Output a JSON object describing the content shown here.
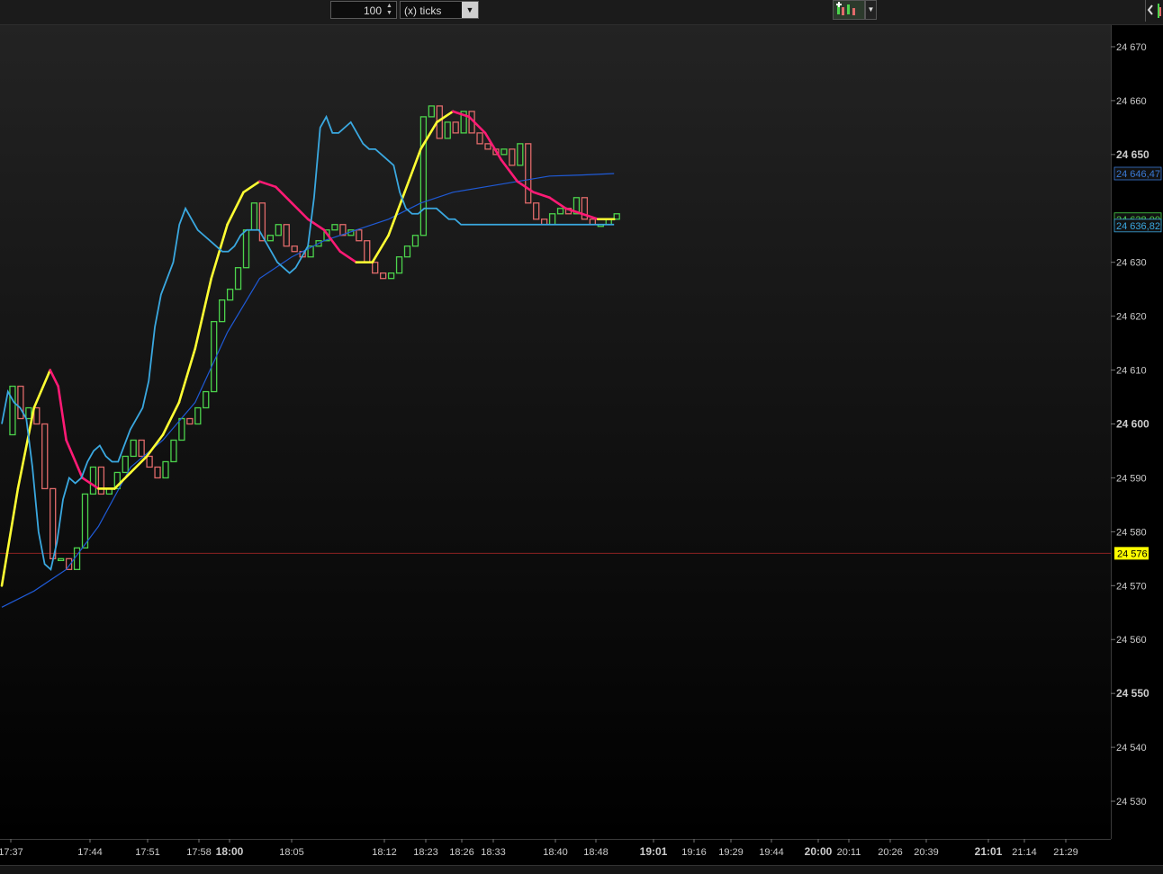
{
  "toolbar": {
    "period_value": "100",
    "period_unit": "(x) ticks"
  },
  "icons": {
    "spinner": "spinner-arrows-icon",
    "dropdown": "chevron-down-icon",
    "drawing_tools": "drawing-tools-icon",
    "chart_settings": "chart-settings-icon"
  },
  "colors": {
    "background_top": "#232323",
    "background_bottom": "#000000",
    "up_bar": "#4cd34c",
    "down_bar": "#e06a6a",
    "ma_fast": "#3aa8e0",
    "ma_rising": "#ffff33",
    "ma_falling": "#ff1a75",
    "ma_slow": "#1f5ad6",
    "reference_line": "#8b2020",
    "reference_label_bg": "#ffff00"
  },
  "chart_data": {
    "type": "line",
    "y_axis": {
      "range": [
        24523,
        24674
      ],
      "ticks": [
        {
          "value": 24670,
          "label": "24 670",
          "bold": false
        },
        {
          "value": 24660,
          "label": "24 660",
          "bold": false
        },
        {
          "value": 24650,
          "label": "24 650",
          "bold": true
        },
        {
          "value": 24630,
          "label": "24 630",
          "bold": false
        },
        {
          "value": 24620,
          "label": "24 620",
          "bold": false
        },
        {
          "value": 24610,
          "label": "24 610",
          "bold": false
        },
        {
          "value": 24600,
          "label": "24 600",
          "bold": true
        },
        {
          "value": 24590,
          "label": "24 590",
          "bold": false
        },
        {
          "value": 24580,
          "label": "24 580",
          "bold": false
        },
        {
          "value": 24570,
          "label": "24 570",
          "bold": false
        },
        {
          "value": 24560,
          "label": "24 560",
          "bold": false
        },
        {
          "value": 24550,
          "label": "24 550",
          "bold": true
        },
        {
          "value": 24540,
          "label": "24 540",
          "bold": false
        },
        {
          "value": 24530,
          "label": "24 530",
          "bold": false
        }
      ]
    },
    "x_axis": {
      "ticks": [
        {
          "label": "17:37",
          "bold": false
        },
        {
          "label": "17:44",
          "bold": false
        },
        {
          "label": "17:51",
          "bold": false
        },
        {
          "label": "17:58",
          "bold": false
        },
        {
          "label": "18:00",
          "bold": true
        },
        {
          "label": "18:05",
          "bold": false
        },
        {
          "label": "18:12",
          "bold": false
        },
        {
          "label": "18:23",
          "bold": false
        },
        {
          "label": "18:26",
          "bold": false
        },
        {
          "label": "18:33",
          "bold": false
        },
        {
          "label": "18:40",
          "bold": false
        },
        {
          "label": "18:48",
          "bold": false
        },
        {
          "label": "19:01",
          "bold": true
        },
        {
          "label": "19:16",
          "bold": false
        },
        {
          "label": "19:29",
          "bold": false
        },
        {
          "label": "19:44",
          "bold": false
        },
        {
          "label": "20:00",
          "bold": true
        },
        {
          "label": "20:11",
          "bold": false
        },
        {
          "label": "20:26",
          "bold": false
        },
        {
          "label": "20:39",
          "bold": false
        },
        {
          "label": "21:01",
          "bold": true
        },
        {
          "label": "21:14",
          "bold": false
        },
        {
          "label": "21:29",
          "bold": false
        }
      ]
    },
    "reference_line": {
      "value": 24576,
      "label": "24 576"
    },
    "last_value_labels": [
      {
        "value": 24646.47,
        "label": "24 646,47",
        "color": "#3a7ad6"
      },
      {
        "value": 24638.0,
        "label": "24 638,00",
        "color": "#4cd34c"
      },
      {
        "value": 24636.82,
        "label": "24 636,82",
        "color": "#3aa8e0"
      }
    ],
    "price_steps": [
      24598,
      24607,
      24601,
      24603,
      24600,
      24588,
      24575,
      24575,
      24573,
      24577,
      24587,
      24592,
      24587,
      24588,
      24591,
      24594,
      24597,
      24594,
      24592,
      24590,
      24593,
      24597,
      24601,
      24600,
      24603,
      24606,
      24619,
      24623,
      24625,
      24629,
      24636,
      24641,
      24634,
      24635,
      24637,
      24633,
      24632,
      24631,
      24633,
      24634,
      24636,
      24637,
      24635,
      24636,
      24634,
      24630,
      24628,
      24627,
      24628,
      24631,
      24633,
      24635,
      24657,
      24659,
      24653,
      24656,
      24654,
      24658,
      24654,
      24652,
      24651,
      24650,
      24651,
      24648,
      24652,
      24641,
      24638,
      24637,
      24639,
      24640,
      24639,
      24642,
      24638,
      24637,
      24637,
      24638,
      24639
    ],
    "series": [
      {
        "style": "fast",
        "x": [
          0.0,
          0.01,
          0.02,
          0.03,
          0.04,
          0.05,
          0.06,
          0.07,
          0.08,
          0.09,
          0.1,
          0.11,
          0.12,
          0.13,
          0.14,
          0.15,
          0.16,
          0.17,
          0.18,
          0.19,
          0.2,
          0.21,
          0.22,
          0.23,
          0.24,
          0.25,
          0.26,
          0.27,
          0.28,
          0.29,
          0.3,
          0.31,
          0.32,
          0.33,
          0.34,
          0.35,
          0.36,
          0.37,
          0.38,
          0.39,
          0.4,
          0.41,
          0.42,
          0.43,
          0.44,
          0.45,
          0.46,
          0.47,
          0.48,
          0.49,
          0.5,
          0.51,
          0.52,
          0.53,
          0.54,
          0.55,
          0.56,
          0.57,
          0.58,
          0.59,
          0.6,
          0.61,
          0.62,
          0.63,
          0.64,
          0.65,
          0.66,
          0.67,
          0.68,
          0.69,
          0.7,
          0.71,
          0.72,
          0.73,
          0.74,
          0.75,
          0.76,
          0.77,
          0.78,
          0.79,
          0.8,
          0.81,
          0.82,
          0.83,
          0.84,
          0.85,
          0.86,
          0.87,
          0.88,
          0.89,
          0.9,
          0.91,
          0.92,
          0.93,
          0.94,
          0.95,
          0.96,
          0.97,
          0.98,
          0.99,
          1.0
        ],
        "values": [
          24600,
          24606,
          24604,
          24603,
          24601,
          24592,
          24580,
          24574,
          24573,
          24578,
          24586,
          24590,
          24589,
          24590,
          24593,
          24595,
          24596,
          24594,
          24593,
          24593,
          24596,
          24599,
          24601,
          24603,
          24608,
          24618,
          24624,
          24627,
          24630,
          24637,
          24640,
          24638,
          24636,
          24635,
          24634,
          24633,
          24632,
          24632,
          24633,
          24635,
          24636,
          24636,
          24636,
          24634,
          24632,
          24630,
          24629,
          24628,
          24629,
          24631,
          24633,
          24642,
          24655,
          24657,
          24654,
          24654,
          24655,
          24656,
          24654,
          24652,
          24651,
          24651,
          24650,
          24649,
          24648,
          24643,
          24640,
          24639,
          24639,
          24640,
          24640,
          24640,
          24639,
          24638,
          24638,
          24637,
          24637,
          24637,
          24637,
          24637,
          24637,
          24637,
          24637,
          24637,
          24637,
          24637,
          24637,
          24637,
          24637,
          24637,
          24637,
          24637,
          24637,
          24637,
          24637,
          24637,
          24637,
          24637,
          24637,
          24637,
          24637
        ]
      },
      {
        "style": "trend",
        "points": [
          [
            0,
            24570
          ],
          [
            2,
            24588
          ],
          [
            4,
            24603
          ],
          [
            6,
            24610
          ],
          [
            7,
            24607
          ],
          [
            8,
            24597
          ],
          [
            10,
            24590
          ],
          [
            12,
            24588
          ],
          [
            14,
            24588
          ],
          [
            16,
            24591
          ],
          [
            18,
            24594
          ],
          [
            20,
            24598
          ],
          [
            22,
            24604
          ],
          [
            24,
            24614
          ],
          [
            26,
            24627
          ],
          [
            28,
            24637
          ],
          [
            30,
            24643
          ],
          [
            32,
            24645
          ],
          [
            34,
            24644
          ],
          [
            36,
            24641
          ],
          [
            38,
            24638
          ],
          [
            40,
            24636
          ],
          [
            42,
            24632
          ],
          [
            44,
            24630
          ],
          [
            46,
            24630
          ],
          [
            48,
            24635
          ],
          [
            50,
            24643
          ],
          [
            52,
            24651
          ],
          [
            54,
            24656
          ],
          [
            56,
            24658
          ],
          [
            58,
            24657
          ],
          [
            60,
            24654
          ],
          [
            62,
            24649
          ],
          [
            64,
            24645
          ],
          [
            66,
            24643
          ],
          [
            68,
            24642
          ],
          [
            70,
            24640
          ],
          [
            72,
            24639
          ],
          [
            74,
            24638
          ],
          [
            76,
            24638
          ]
        ]
      },
      {
        "style": "slow",
        "points": [
          [
            0,
            24566
          ],
          [
            4,
            24569
          ],
          [
            8,
            24573
          ],
          [
            12,
            24581
          ],
          [
            16,
            24592
          ],
          [
            20,
            24597
          ],
          [
            24,
            24604
          ],
          [
            28,
            24617
          ],
          [
            32,
            24627
          ],
          [
            36,
            24631
          ],
          [
            40,
            24634
          ],
          [
            44,
            24636
          ],
          [
            48,
            24638
          ],
          [
            52,
            24641
          ],
          [
            56,
            24643
          ],
          [
            60,
            24644
          ],
          [
            64,
            24645
          ],
          [
            68,
            24646
          ],
          [
            72,
            24646.2
          ],
          [
            76,
            24646.47
          ]
        ]
      }
    ]
  }
}
